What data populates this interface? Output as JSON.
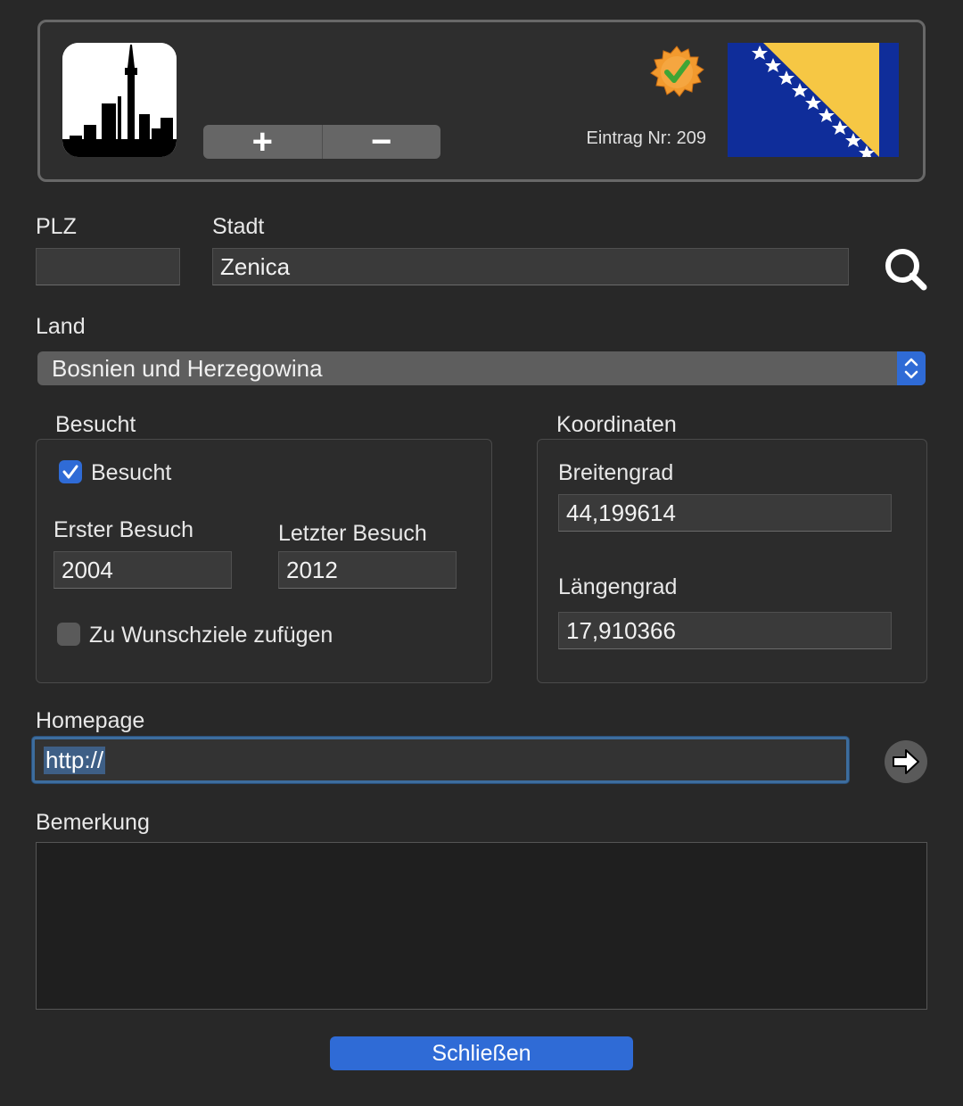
{
  "header": {
    "entry_number": "Eintrag Nr: 209",
    "add_label": "+",
    "remove_label": "−"
  },
  "icons": {
    "city": "city-skyline-icon",
    "badge": "verified-badge-icon",
    "flag": "bosnia-flag-icon",
    "search": "search-icon",
    "go": "arrow-right-icon",
    "select_arrows": "chevron-updown-icon"
  },
  "colors": {
    "accent": "#2f6bd6",
    "flag_blue": "#0f2d9a",
    "flag_yellow": "#f6c744",
    "badge_orange": "#f29a2e",
    "check_green": "#3fa535"
  },
  "form": {
    "plz_label": "PLZ",
    "plz_value": "",
    "stadt_label": "Stadt",
    "stadt_value": "Zenica",
    "land_label": "Land",
    "land_value": "Bosnien und Herzegowina"
  },
  "besucht": {
    "group_title": "Besucht",
    "checkbox_label": "Besucht",
    "checked": true,
    "first_visit_label": "Erster Besuch",
    "first_visit_value": "2004",
    "last_visit_label": "Letzter Besuch",
    "last_visit_value": "2012",
    "wish_label": "Zu Wunschziele zufügen",
    "wish_checked": false
  },
  "koordinaten": {
    "group_title": "Koordinaten",
    "lat_label": "Breitengrad",
    "lat_value": "44,199614",
    "lon_label": "Längengrad",
    "lon_value": "17,910366"
  },
  "homepage": {
    "label": "Homepage",
    "value": "http://"
  },
  "bemerkung": {
    "label": "Bemerkung",
    "value": ""
  },
  "footer": {
    "close_label": "Schließen"
  }
}
